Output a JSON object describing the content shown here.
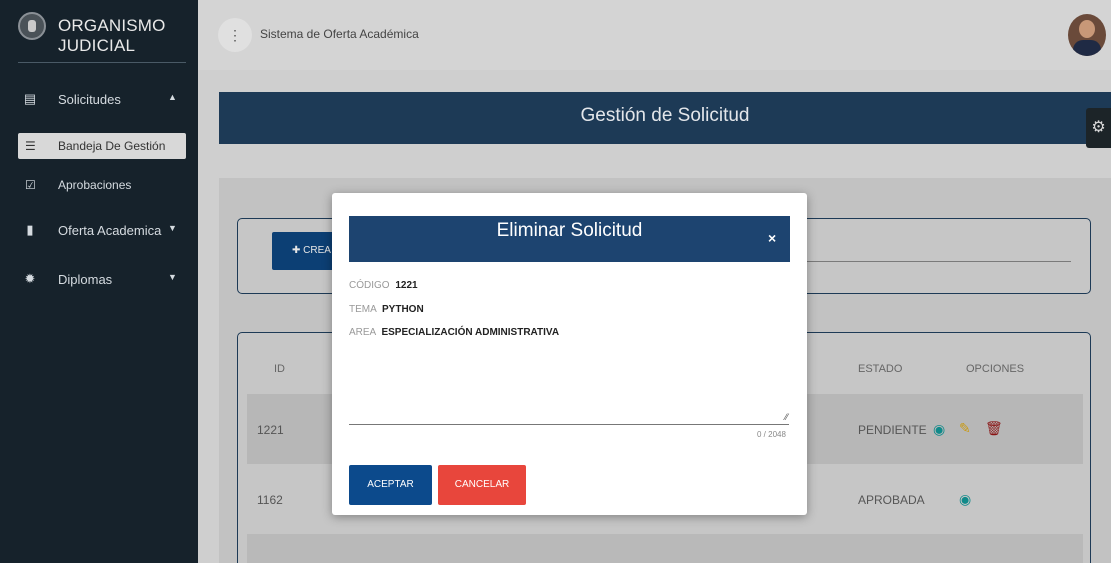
{
  "sidebar": {
    "brand": "ORGANISMO JUDICIAL",
    "items": [
      {
        "label": "Solicitudes",
        "icon": "list-icon"
      },
      {
        "label": "Bandeja De Gestión",
        "icon": "bullet-list-icon"
      },
      {
        "label": "Aprobaciones",
        "icon": "checkbox-icon"
      },
      {
        "label": "Oferta Academica",
        "icon": "book-icon"
      },
      {
        "label": "Diplomas",
        "icon": "seal-icon"
      }
    ]
  },
  "topbar": {
    "title": "Sistema de Oferta Académica",
    "menu_icon": "vertical-dots-icon"
  },
  "page": {
    "header": "Gestión de Solicitud",
    "create_label": "CREA"
  },
  "table": {
    "headers": {
      "id": "ID",
      "estado": "ESTADO",
      "opciones": "OPCIONES"
    },
    "rows": [
      {
        "id": "1221",
        "estado": "PENDIENTE"
      },
      {
        "id": "1162",
        "estado": "APROBADA"
      }
    ]
  },
  "modal": {
    "title": "Eliminar Solicitud",
    "close": "×",
    "fields": [
      {
        "label": "CÓDIGO",
        "value": "1221"
      },
      {
        "label": "TEMA",
        "value": "PYTHON"
      },
      {
        "label": "AREA",
        "value": "ESPECIALIZACIÓN ADMINISTRATIVA"
      }
    ],
    "counter": "0 / 2048",
    "accept": "ACEPTAR",
    "cancel": "CANCELAR"
  },
  "colors": {
    "sidebar": "#16222b",
    "header": "#1d3a56",
    "modal_header": "#1d4470",
    "accept": "#0c4a8c",
    "cancel": "#e8463c"
  }
}
